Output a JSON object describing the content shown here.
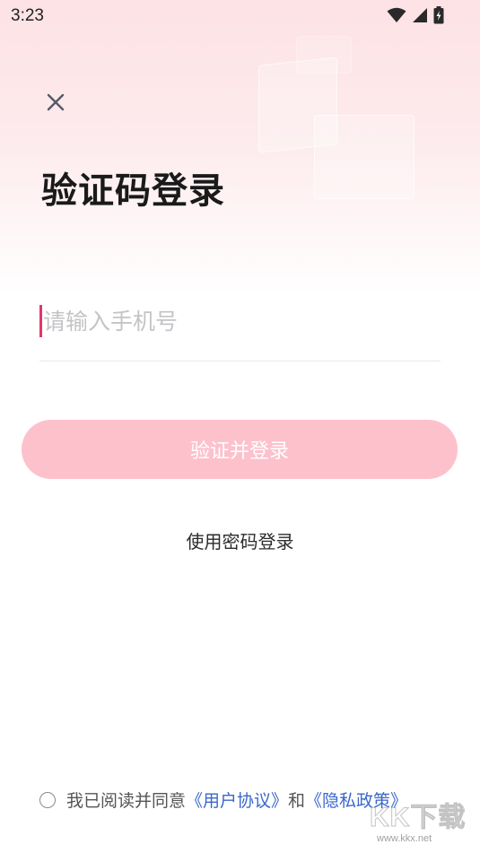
{
  "status_bar": {
    "time": "3:23",
    "icons": [
      "wifi-icon",
      "signal-icon",
      "battery-icon"
    ]
  },
  "header": {
    "close_icon": "close-icon",
    "title": "验证码登录"
  },
  "form": {
    "phone_placeholder": "请输入手机号",
    "phone_value": "",
    "submit_label": "验证并登录",
    "password_login_label": "使用密码登录"
  },
  "agreement": {
    "prefix": "我已阅读并同意",
    "user_agreement": "《用户协议》",
    "conjunction": "和",
    "privacy_policy": "《隐私政策》",
    "checked": false
  },
  "watermark": {
    "logo": "KK下载",
    "url": "www.kkx.net"
  },
  "colors": {
    "accent": "#e4356a",
    "button_disabled": "#fdc1cc",
    "link": "#3a67c9",
    "title": "#1a1a1a"
  }
}
